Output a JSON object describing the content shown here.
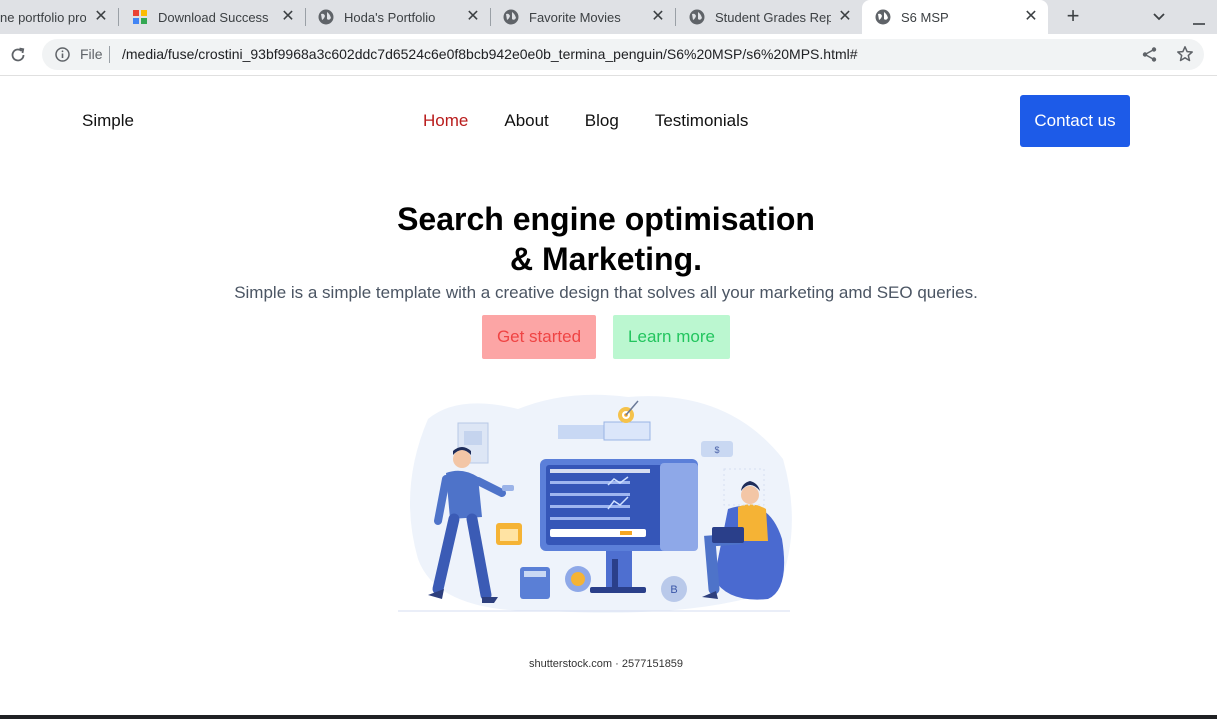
{
  "browser": {
    "tabs": [
      {
        "title": "ne portfolio pro",
        "active": false
      },
      {
        "title": "Download Success",
        "active": false
      },
      {
        "title": "Hoda's Portfolio",
        "active": false
      },
      {
        "title": "Favorite Movies",
        "active": false
      },
      {
        "title": "Student Grades Rep",
        "active": false
      },
      {
        "title": "S6 MSP",
        "active": true
      }
    ],
    "close_glyph": "✕",
    "new_tab_glyph": "+",
    "url_scheme": "File",
    "url": "/media/fuse/crostini_93bf9968a3c602ddc7d6524c6e0f8bcb942e0e0b_termina_penguin/S6%20MSP/s6%20MPS.html#"
  },
  "site": {
    "brand": "Simple",
    "nav": [
      {
        "label": "Home",
        "active": true
      },
      {
        "label": "About",
        "active": false
      },
      {
        "label": "Blog",
        "active": false
      },
      {
        "label": "Testimonials",
        "active": false
      }
    ],
    "contact_label": "Contact us"
  },
  "hero": {
    "title_line1": "Search engine optimisation",
    "title_line2": "& Marketing.",
    "subtitle": "Simple is a simple template with a creative design that solves all your marketing amd SEO queries.",
    "primary_label": "Get started",
    "secondary_label": "Learn more",
    "watermark": "shutterstock.com · 2577151859"
  },
  "colors": {
    "accent": "#1d5be8",
    "nav_active": "#b91c1c",
    "primary_bg": "#fca5a5",
    "secondary_bg": "#bbf7d0"
  },
  "icons": [
    "globe-icon",
    "google-drive-icon",
    "close-icon",
    "plus-icon",
    "chevron-down-icon",
    "minimize-icon",
    "reload-icon",
    "info-icon",
    "share-icon",
    "star-icon"
  ]
}
